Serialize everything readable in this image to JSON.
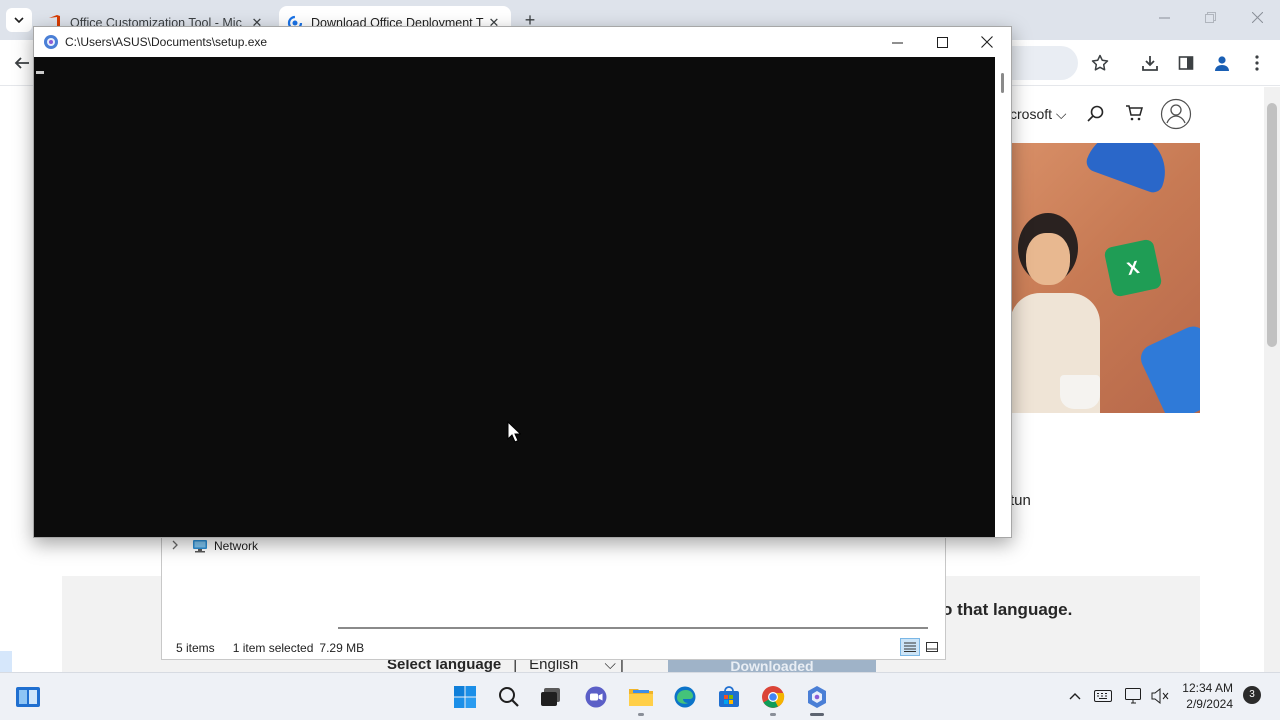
{
  "browser": {
    "tabs": [
      {
        "title": "Office Customization Tool - Mic",
        "active": false
      },
      {
        "title": "Download Office Deployment T",
        "active": true
      }
    ],
    "close_glyph": "✕",
    "new_tab_glyph": "+"
  },
  "page": {
    "nav_text": "crosoft ⌵",
    "body_fragment": "tun",
    "band_text": "o that language.",
    "select_label": "Select language",
    "select_sep": "|",
    "select_value": "English",
    "select_arrow": "⌵ |",
    "downloaded_label": "Downloaded"
  },
  "explorer": {
    "nav_item": "Network",
    "status_items": "5 items",
    "status_selected": "1 item selected",
    "status_size": "7.29 MB"
  },
  "console": {
    "title": "C:\\Users\\ASUS\\Documents\\setup.exe"
  },
  "taskbar": {
    "time": "12:34 AM",
    "date": "2/9/2024",
    "notifications": "3"
  },
  "colors": {
    "tabstrip": "#dee3eb",
    "console_bg": "#0c0c0c",
    "taskbar": "#eef1f6",
    "accent": "#0a64c8"
  }
}
